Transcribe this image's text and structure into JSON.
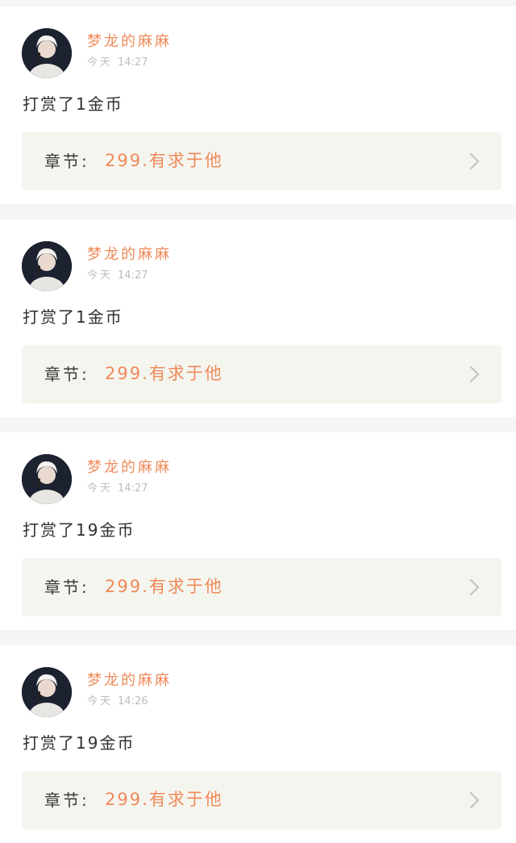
{
  "feed": {
    "items": [
      {
        "user": "梦龙的麻麻",
        "day": "今天",
        "time": "14:27",
        "reward_text": "打赏了1金币",
        "chapter_label": "章节:",
        "chapter_title": "299.有求于他"
      },
      {
        "user": "梦龙的麻麻",
        "day": "今天",
        "time": "14:27",
        "reward_text": "打赏了1金币",
        "chapter_label": "章节:",
        "chapter_title": "299.有求于他"
      },
      {
        "user": "梦龙的麻麻",
        "day": "今天",
        "time": "14:27",
        "reward_text": "打赏了19金币",
        "chapter_label": "章节:",
        "chapter_title": "299.有求于他"
      },
      {
        "user": "梦龙的麻麻",
        "day": "今天",
        "time": "14:26",
        "reward_text": "打赏了19金币",
        "chapter_label": "章节:",
        "chapter_title": "299.有求于他"
      }
    ]
  },
  "icons": {
    "chevron": "chevron-right-icon",
    "avatar": "user-avatar"
  },
  "colors": {
    "accent": "#ef8a5a",
    "text": "#2f2f2f",
    "muted": "#bdbdbd",
    "chapter_bg": "#f5f5ef",
    "page_bg": "#f5f5f5"
  }
}
